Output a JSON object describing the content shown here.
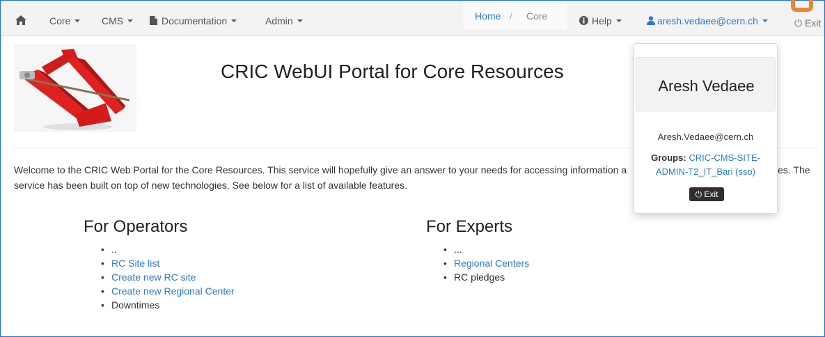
{
  "nav": {
    "core": "Core",
    "cms": "CMS",
    "documentation": "Documentation",
    "admin": "Admin",
    "help": "Help",
    "user": "aresh.vedaee@cern.ch",
    "exit": "Exit"
  },
  "breadcrumb": {
    "home": "Home",
    "separator": "/",
    "current": "Core"
  },
  "page": {
    "title": "CRIC WebUI Portal for Core Resources",
    "intro_line1": "Welcome to the CRIC Web Portal for the Core Resources. This service will hopefully give an answer to your needs for accessing information a",
    "intro_line1_end": "ces. The",
    "intro_line2": "service has been built on top of new technologies. See below for a list of available features."
  },
  "operators": {
    "title": "For Operators",
    "items": [
      {
        "label": "..",
        "link": false
      },
      {
        "label": "RC Site list",
        "link": true
      },
      {
        "label": "Create new RC site",
        "link": true
      },
      {
        "label": "Create new Regional Center",
        "link": true
      },
      {
        "label": "Downtimes",
        "link": false
      }
    ]
  },
  "experts": {
    "title": "For Experts",
    "items": [
      {
        "label": "...",
        "link": false
      },
      {
        "label": "Regional Centers",
        "link": true
      },
      {
        "label": "RC pledges",
        "link": false
      }
    ]
  },
  "popover": {
    "name": "Aresh Vedaee",
    "email": "Aresh.Vedaee@cern.ch",
    "groups_label": "Groups:",
    "groups_value": "CRIC-CMS-SITE-ADMIN-T2_IT_Bari (sso)",
    "exit": "Exit"
  },
  "colors": {
    "accent": "#2a7ad6",
    "highlight": "#e8863a",
    "jack": "#e02121"
  }
}
